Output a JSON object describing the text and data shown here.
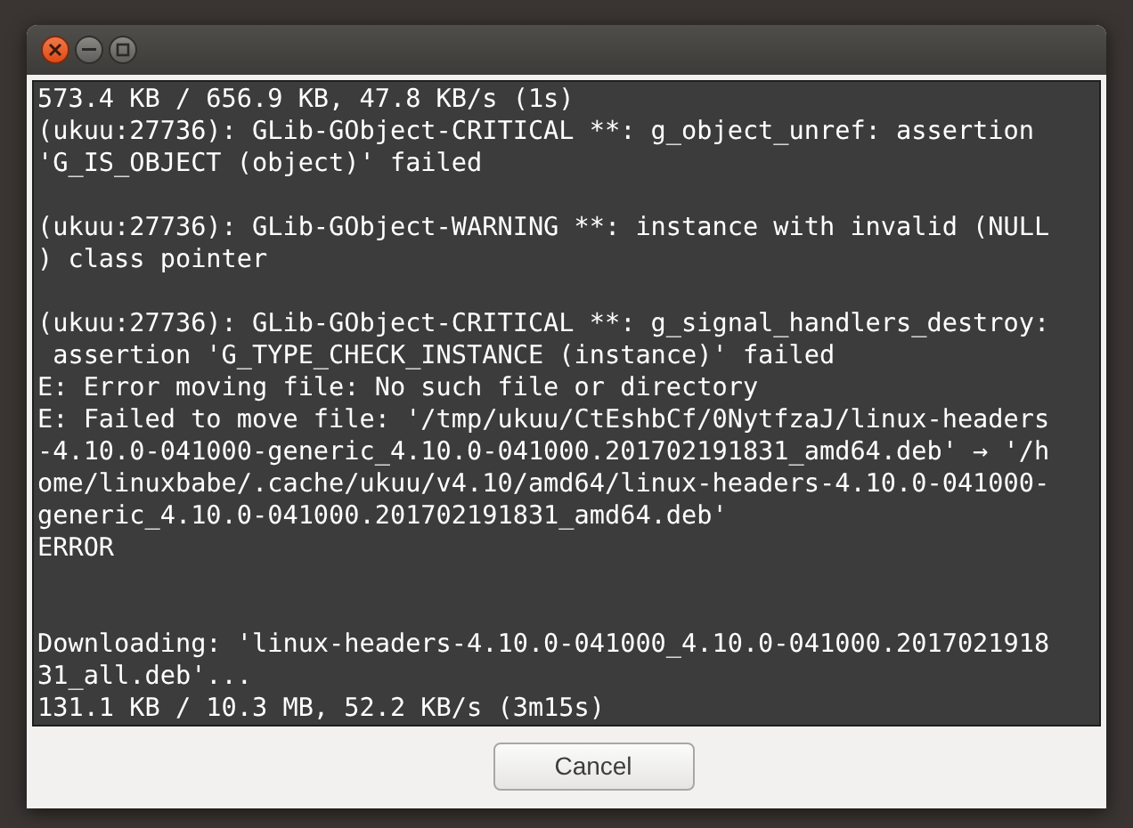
{
  "window": {
    "controls": [
      {
        "kind": "close"
      },
      {
        "kind": "minimize"
      },
      {
        "kind": "maximize"
      }
    ]
  },
  "terminal": {
    "lines": [
      {
        "kind": "text",
        "text": "573.4 KB / 656.9 KB, 47.8 KB/s (1s)"
      },
      {
        "kind": "text",
        "text": "(ukuu:27736): GLib-GObject-CRITICAL **: g_object_unref: assertion"
      },
      {
        "kind": "text",
        "text": "'G_IS_OBJECT (object)' failed"
      },
      {
        "kind": "blank"
      },
      {
        "kind": "text",
        "text": "(ukuu:27736): GLib-GObject-WARNING **: instance with invalid (NULL"
      },
      {
        "kind": "text",
        "text": ") class pointer"
      },
      {
        "kind": "blank"
      },
      {
        "kind": "text",
        "text": "(ukuu:27736): GLib-GObject-CRITICAL **: g_signal_handlers_destroy:"
      },
      {
        "kind": "text",
        "text": " assertion 'G_TYPE_CHECK_INSTANCE (instance)' failed"
      },
      {
        "kind": "text",
        "text": "E: Error moving file: No such file or directory"
      },
      {
        "kind": "text",
        "text": "E: Failed to move file: '/tmp/ukuu/CtEshbCf/0NytfzaJ/linux-headers"
      },
      {
        "kind": "text",
        "text": "-4.10.0-041000-generic_4.10.0-041000.201702191831_amd64.deb' → '/h"
      },
      {
        "kind": "text",
        "text": "ome/linuxbabe/.cache/ukuu/v4.10/amd64/linux-headers-4.10.0-041000-"
      },
      {
        "kind": "text",
        "text": "generic_4.10.0-041000.201702191831_amd64.deb'"
      },
      {
        "kind": "text",
        "text": "ERROR"
      },
      {
        "kind": "blank"
      },
      {
        "kind": "blank"
      },
      {
        "kind": "text",
        "text": "Downloading: 'linux-headers-4.10.0-041000_4.10.0-041000.2017021918"
      },
      {
        "kind": "text",
        "text": "31_all.deb'..."
      },
      {
        "kind": "text",
        "text": "131.1 KB / 10.3 MB, 52.2 KB/s (3m15s)"
      }
    ]
  },
  "buttons": [
    {
      "label": "Cancel"
    }
  ]
}
